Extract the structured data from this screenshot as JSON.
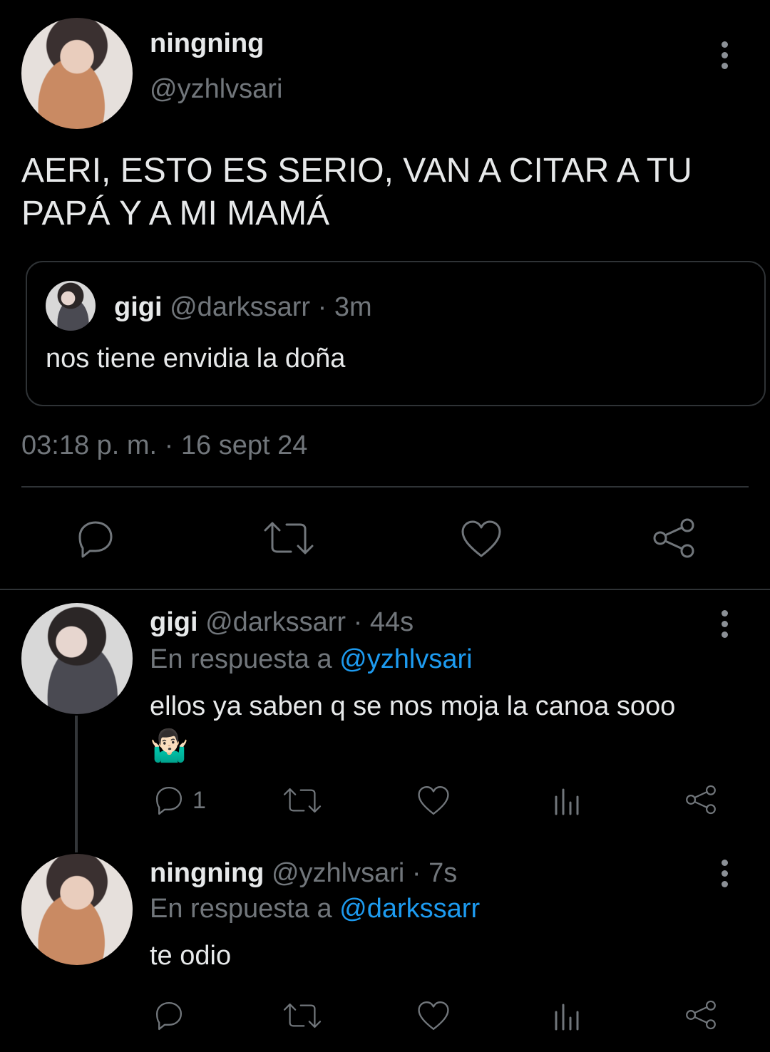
{
  "main_tweet": {
    "name": "ningning",
    "handle": "@yzhlvsari",
    "text_line1": "AERI, ESTO ES SERIO, VAN A CITAR A TU",
    "text_line2": "PAPÁ Y A MI MAMÁ",
    "timestamp": "03:18 p. m. · 16 sept 24",
    "quote": {
      "name": "gigi",
      "handle": "@darkssarr",
      "time": "· 3m",
      "text": "nos tiene envidia la doña"
    }
  },
  "replies": [
    {
      "name": "gigi",
      "handle": "@darkssarr",
      "time": "· 44s",
      "reply_prefix": "En respuesta a",
      "reply_to": "@yzhlvsari",
      "text": "ellos ya saben q se nos moja la canoa sooo",
      "emoji": "🤷🏻‍♂️",
      "reply_count": "1"
    },
    {
      "name": "ningning",
      "handle": "@yzhlvsari",
      "time": "· 7s",
      "reply_prefix": "En respuesta a",
      "reply_to": "@darkssarr",
      "text": "te odio"
    }
  ],
  "colors": {
    "background": "#000000",
    "text": "#e7e9ea",
    "muted": "#71767b",
    "link": "#1d9bf0"
  }
}
